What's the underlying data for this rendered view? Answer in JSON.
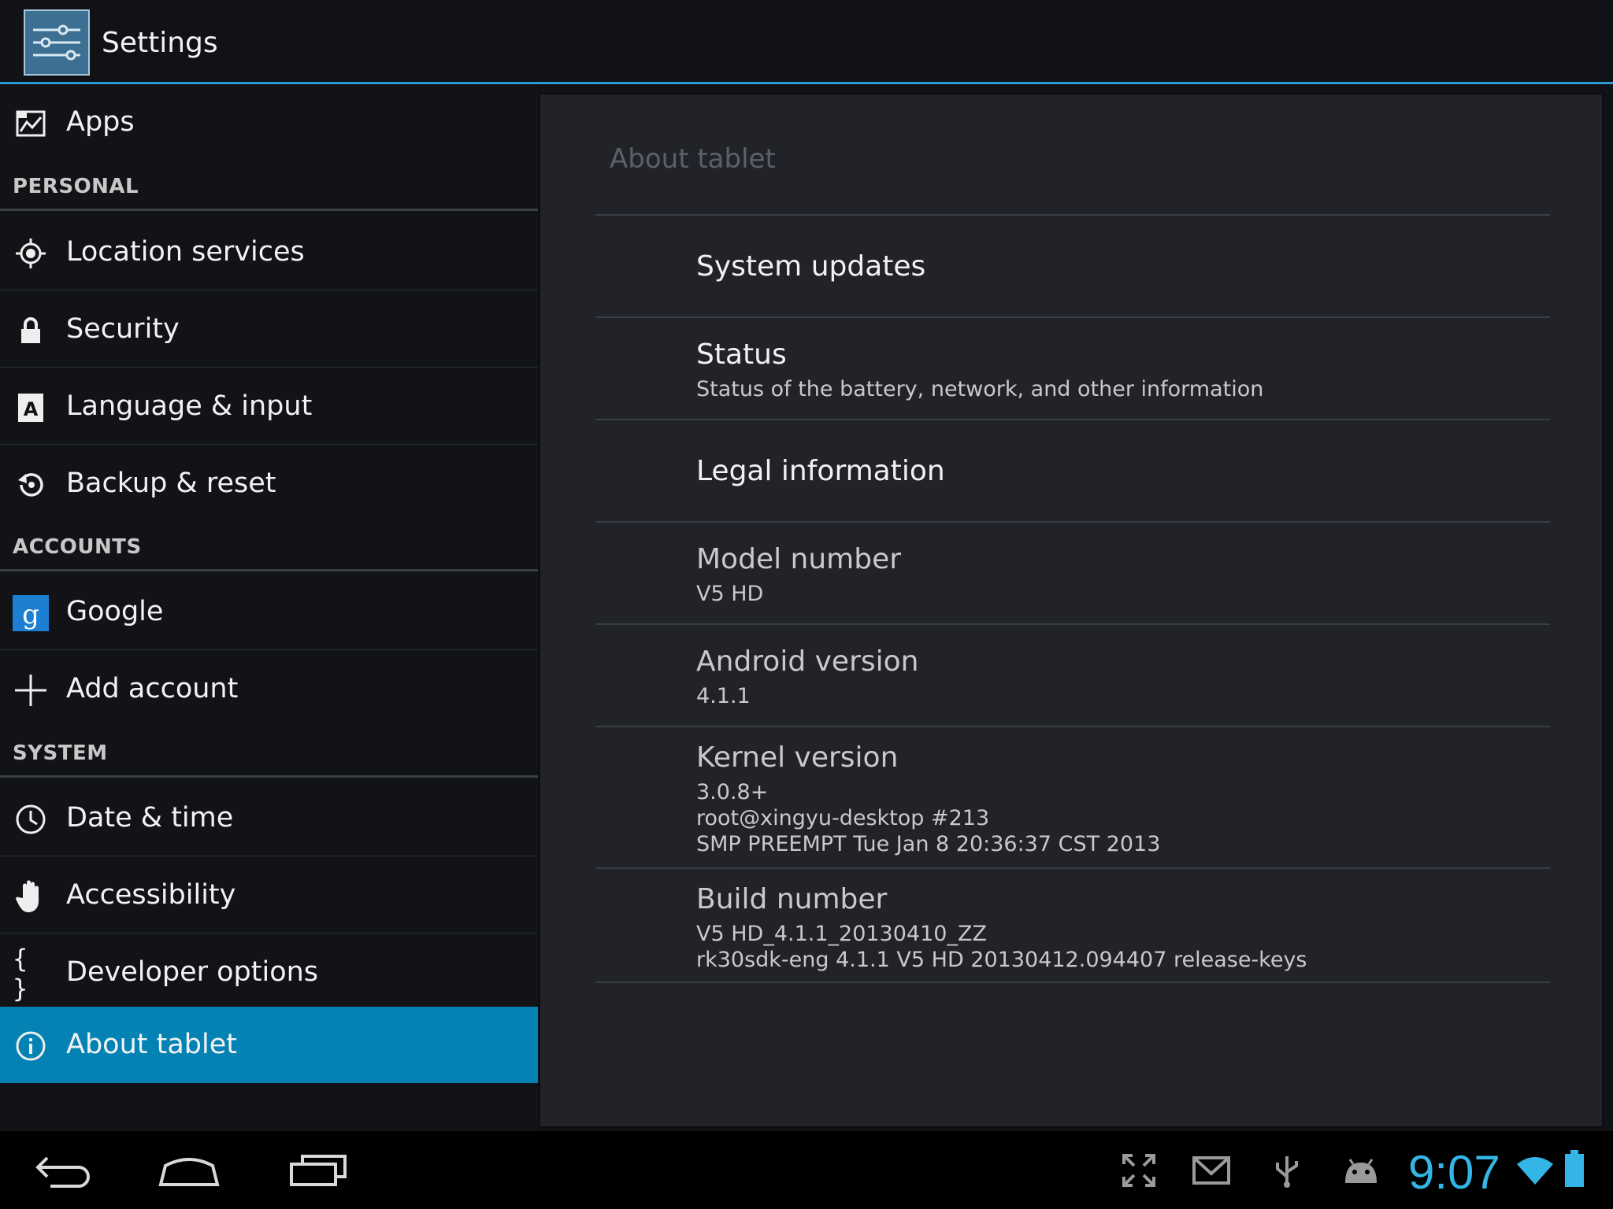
{
  "app": {
    "title": "Settings",
    "icon": "settings-sliders-icon"
  },
  "sidebar": {
    "apps": {
      "label": "Apps",
      "icon": "apps-icon"
    },
    "personal_header": "PERSONAL",
    "personal": [
      {
        "label": "Location services",
        "icon": "location-icon"
      },
      {
        "label": "Security",
        "icon": "lock-icon"
      },
      {
        "label": "Language & input",
        "icon": "language-icon"
      },
      {
        "label": "Backup & reset",
        "icon": "backup-icon"
      }
    ],
    "accounts_header": "ACCOUNTS",
    "accounts": [
      {
        "label": "Google",
        "icon": "google-icon"
      },
      {
        "label": "Add account",
        "icon": "plus-icon"
      }
    ],
    "system_header": "SYSTEM",
    "system": [
      {
        "label": "Date & time",
        "icon": "clock-icon"
      },
      {
        "label": "Accessibility",
        "icon": "hand-icon"
      },
      {
        "label": "Developer options",
        "icon": "braces-icon"
      },
      {
        "label": "About tablet",
        "icon": "info-icon",
        "selected": true
      }
    ]
  },
  "about": {
    "title": "About tablet",
    "system_updates": "System updates",
    "status": {
      "title": "Status",
      "summary": "Status of the battery, network, and other information"
    },
    "legal": "Legal information",
    "model": {
      "title": "Model number",
      "value": "V5 HD"
    },
    "android": {
      "title": "Android version",
      "value": "4.1.1"
    },
    "kernel": {
      "title": "Kernel version",
      "line1": "3.0.8+",
      "line2": "root@xingyu-desktop #213",
      "line3": "SMP PREEMPT Tue Jan 8 20:36:37 CST 2013"
    },
    "build": {
      "title": "Build number",
      "line1": "V5 HD_4.1.1_20130410_ZZ",
      "line2": "rk30sdk-eng 4.1.1 V5 HD 20130412.094407 release-keys"
    }
  },
  "navbar": {
    "buttons": [
      "back-icon",
      "home-icon",
      "recent-apps-icon"
    ],
    "status_icons": [
      "fullscreen-icon",
      "gmail-icon",
      "usb-icon",
      "android-debug-icon",
      "wifi-icon",
      "battery-icon"
    ],
    "time": "9:07"
  },
  "colors": {
    "accent": "#33b5e5",
    "selected": "#0482b3",
    "divider_blue": "#2a9ad2"
  }
}
